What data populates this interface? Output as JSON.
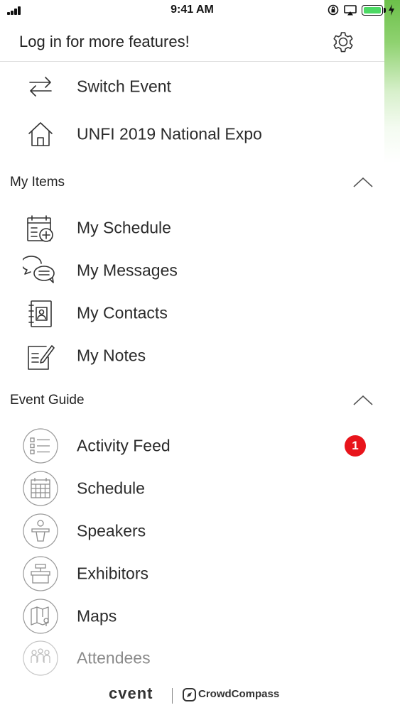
{
  "status_bar": {
    "time": "9:41 AM",
    "icons": [
      "signal-icon",
      "orientation-lock-icon",
      "airplay-icon",
      "battery-icon",
      "charging-icon"
    ]
  },
  "header": {
    "title": "Log in for more features!",
    "settings_icon": "gear-icon"
  },
  "top_items": [
    {
      "label": "Switch Event",
      "icon": "switch-arrows-icon"
    },
    {
      "label": "UNFI 2019 National Expo",
      "icon": "home-icon"
    }
  ],
  "my_items": {
    "title": "My Items",
    "items": [
      {
        "label": "My Schedule",
        "icon": "calendar-add-icon"
      },
      {
        "label": "My Messages",
        "icon": "chat-bubbles-icon"
      },
      {
        "label": "My Contacts",
        "icon": "address-book-icon"
      },
      {
        "label": "My Notes",
        "icon": "notepad-icon"
      }
    ]
  },
  "event_guide": {
    "title": "Event Guide",
    "items": [
      {
        "label": "Activity Feed",
        "icon": "activity-list-icon",
        "badge": "1"
      },
      {
        "label": "Schedule",
        "icon": "calendar-icon"
      },
      {
        "label": "Speakers",
        "icon": "speaker-podium-icon"
      },
      {
        "label": "Exhibitors",
        "icon": "exhibitor-booth-icon"
      },
      {
        "label": "Maps",
        "icon": "map-icon"
      },
      {
        "label": "Attendees",
        "icon": "people-icon"
      }
    ]
  },
  "footer": {
    "brand": "cvent",
    "partner": "CrowdCompass"
  },
  "colors": {
    "badge": "#e8141b",
    "battery": "#4cd964",
    "edge_accent": "#6cc04a"
  }
}
